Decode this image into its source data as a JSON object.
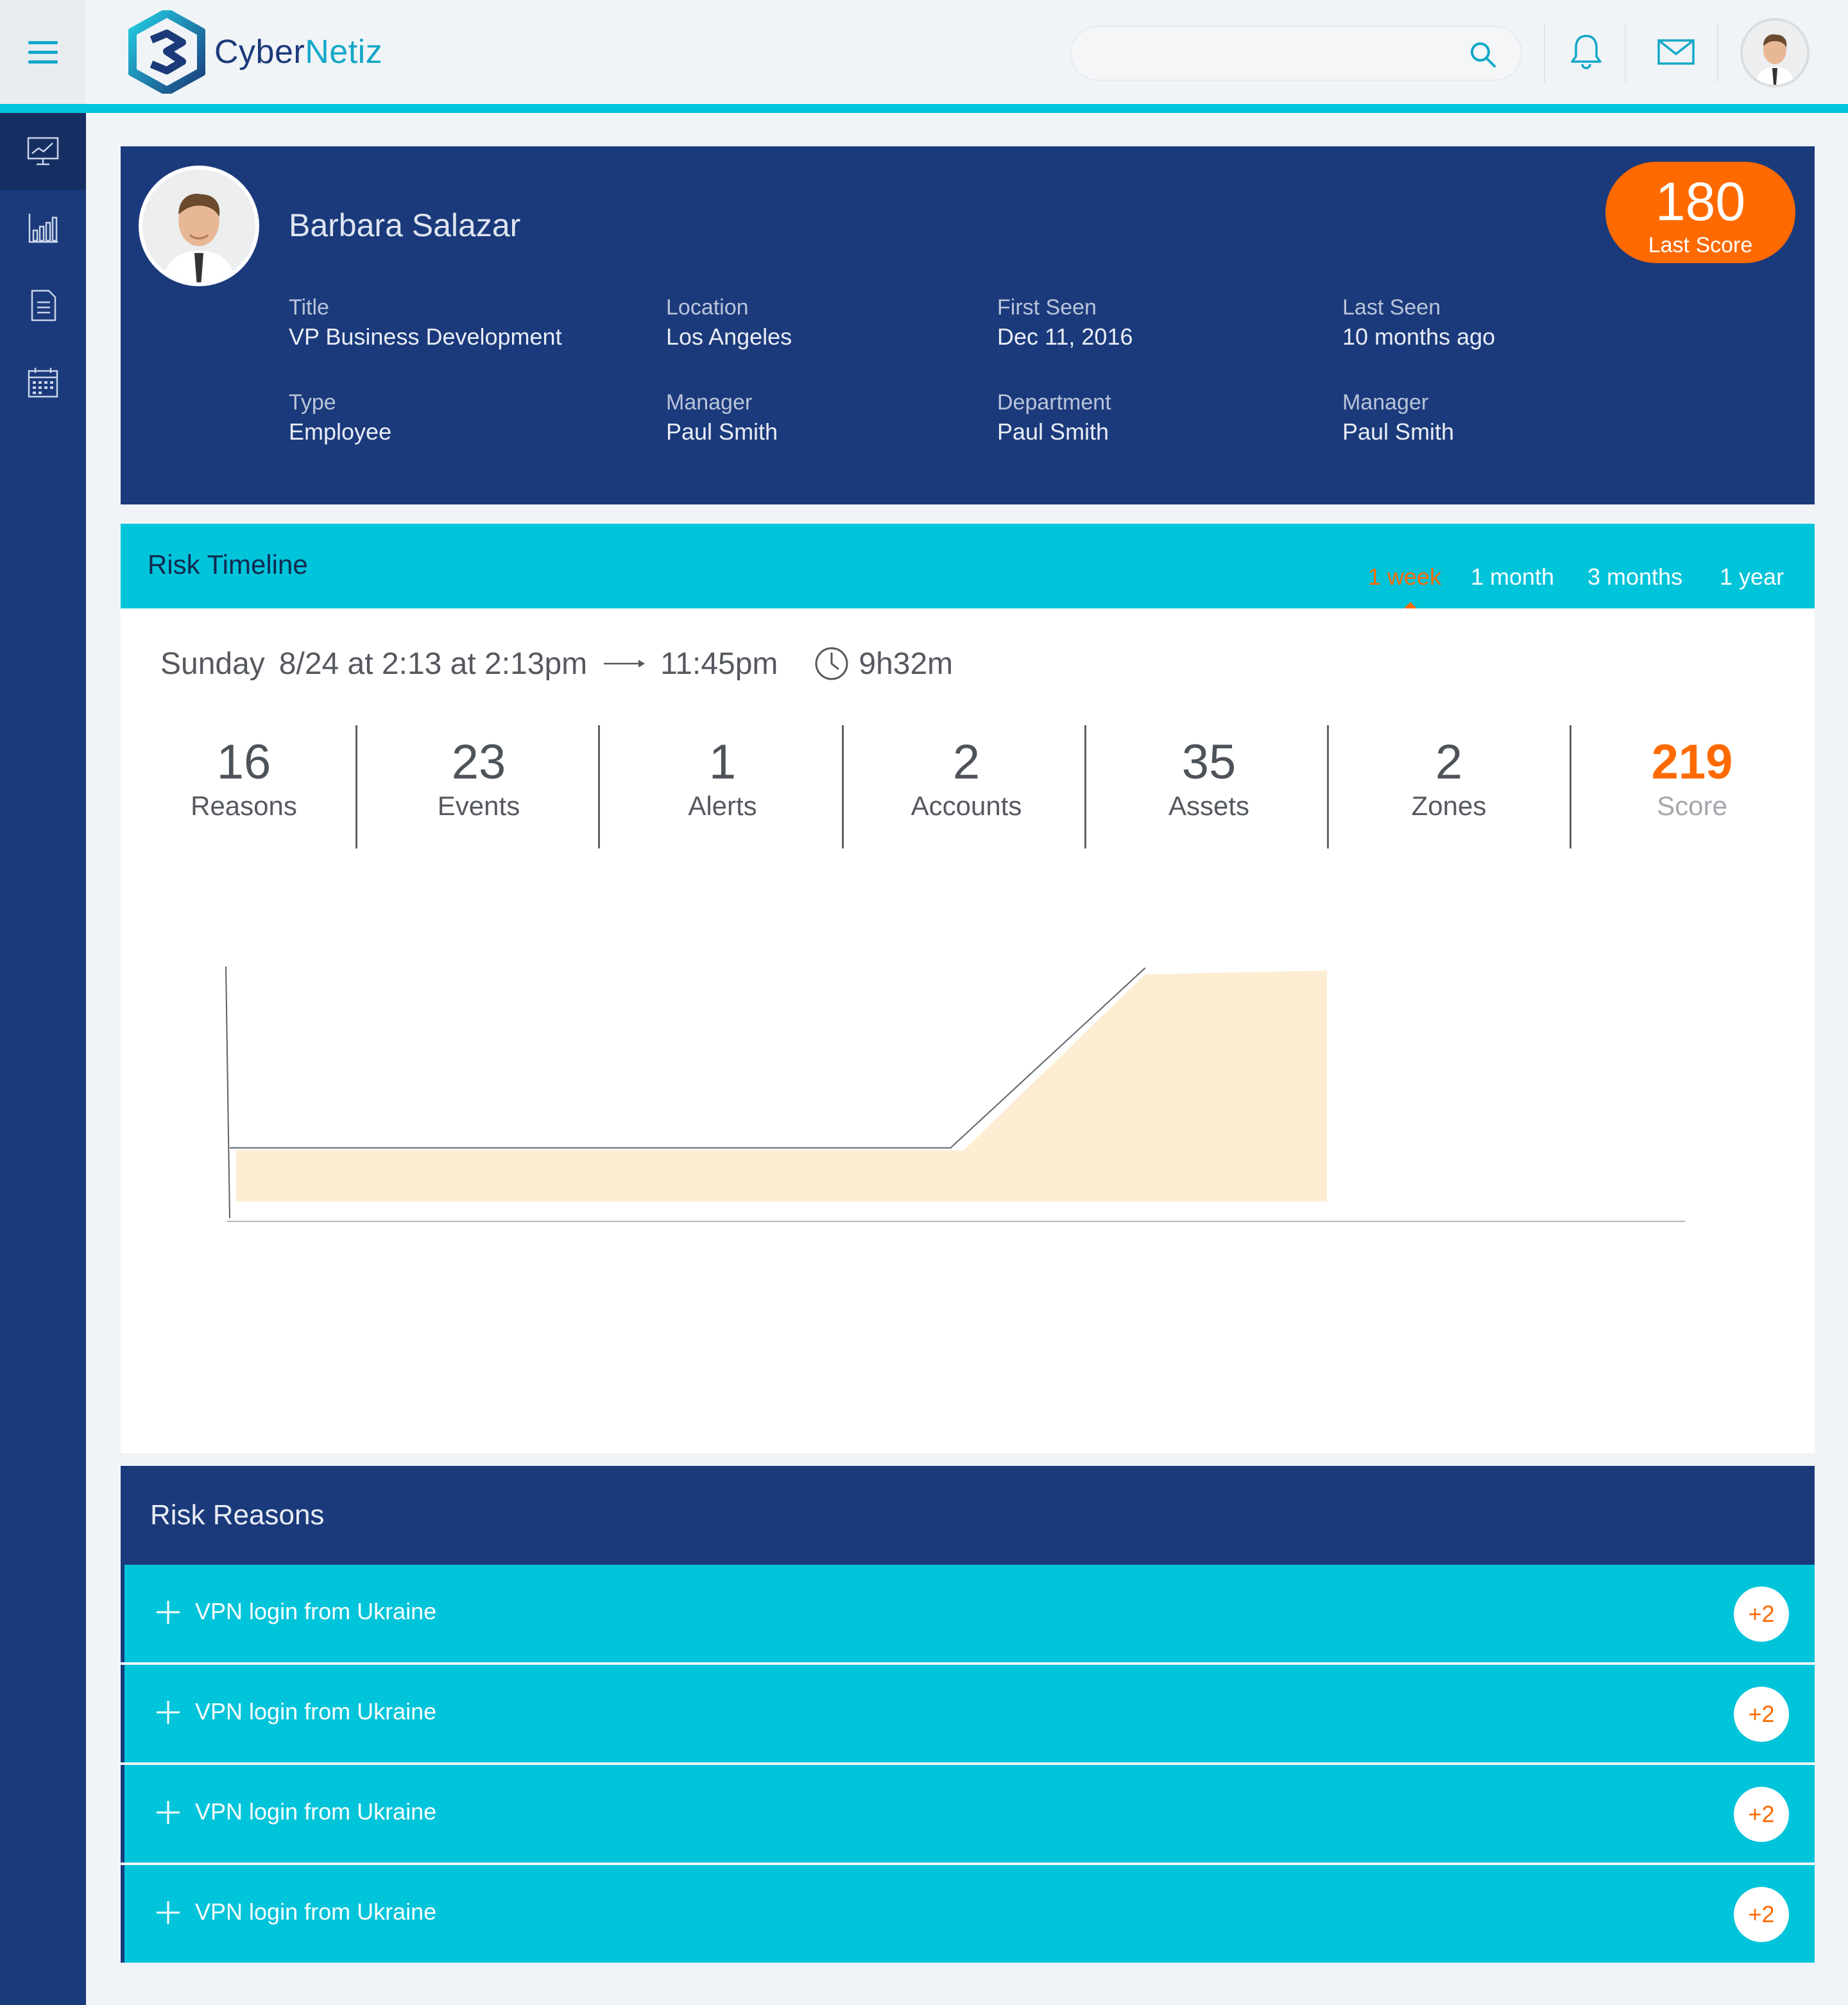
{
  "header": {
    "brand_part1": "Cyber",
    "brand_part2": "Netiz",
    "search_placeholder": "",
    "icons": [
      "menu-icon",
      "search-icon",
      "bell-icon",
      "mail-icon"
    ]
  },
  "sidebar": {
    "items": [
      {
        "icon": "dashboard-monitor-icon",
        "active": true
      },
      {
        "icon": "bar-chart-icon",
        "active": false
      },
      {
        "icon": "document-list-icon",
        "active": false
      },
      {
        "icon": "calendar-icon",
        "active": false
      }
    ]
  },
  "profile": {
    "name": "Barbara Salazar",
    "score": "180",
    "score_label": "Last Score",
    "fields": [
      {
        "label": "Title",
        "value": "VP Business Development"
      },
      {
        "label": "Location",
        "value": "Los Angeles"
      },
      {
        "label": "First Seen",
        "value": "Dec 11, 2016"
      },
      {
        "label": "Last Seen",
        "value": "10 months ago"
      },
      {
        "label": "Type",
        "value": "Employee"
      },
      {
        "label": "Manager",
        "value": "Paul Smith"
      },
      {
        "label": "Department",
        "value": "Paul Smith"
      },
      {
        "label": "Manager",
        "value": "Paul Smith"
      }
    ]
  },
  "timeline": {
    "title": "Risk Timeline",
    "tabs": [
      "1 week",
      "1 month",
      "3 months",
      "1 year"
    ],
    "active_tab": "1 week",
    "session": {
      "day": "Sunday",
      "start": "8/24 at 2:13 at 2:13pm",
      "end": "11:45pm",
      "duration": "9h32m"
    },
    "stats": [
      {
        "value": "16",
        "label": "Reasons"
      },
      {
        "value": "23",
        "label": "Events"
      },
      {
        "value": "1",
        "label": "Alerts"
      },
      {
        "value": "2",
        "label": "Accounts"
      },
      {
        "value": "35",
        "label": "Assets"
      },
      {
        "value": "2",
        "label": "Zones"
      },
      {
        "value": "219",
        "label": "Score"
      }
    ]
  },
  "chart_data": {
    "type": "area",
    "title": "",
    "xlabel": "",
    "ylabel": "",
    "grid": false,
    "fill_color": "#fdeed3",
    "line_color": "#5d6166",
    "series": [
      {
        "values": [
          0.19,
          0.19,
          0.19,
          0.19,
          0.19,
          0.98,
          0.98
        ]
      }
    ]
  },
  "reasons": {
    "title": "Risk Reasons",
    "items": [
      {
        "text": "VPN login from Ukraine",
        "badge": "+2"
      },
      {
        "text": "VPN login from Ukraine",
        "badge": "+2"
      },
      {
        "text": "VPN login from Ukraine",
        "badge": "+2"
      },
      {
        "text": "VPN login from Ukraine",
        "badge": "+2"
      }
    ]
  },
  "colors": {
    "navy": "#1b3a7b",
    "cyan": "#00c4da",
    "orange": "#ff6a00",
    "area_fill": "#fdeed3"
  }
}
